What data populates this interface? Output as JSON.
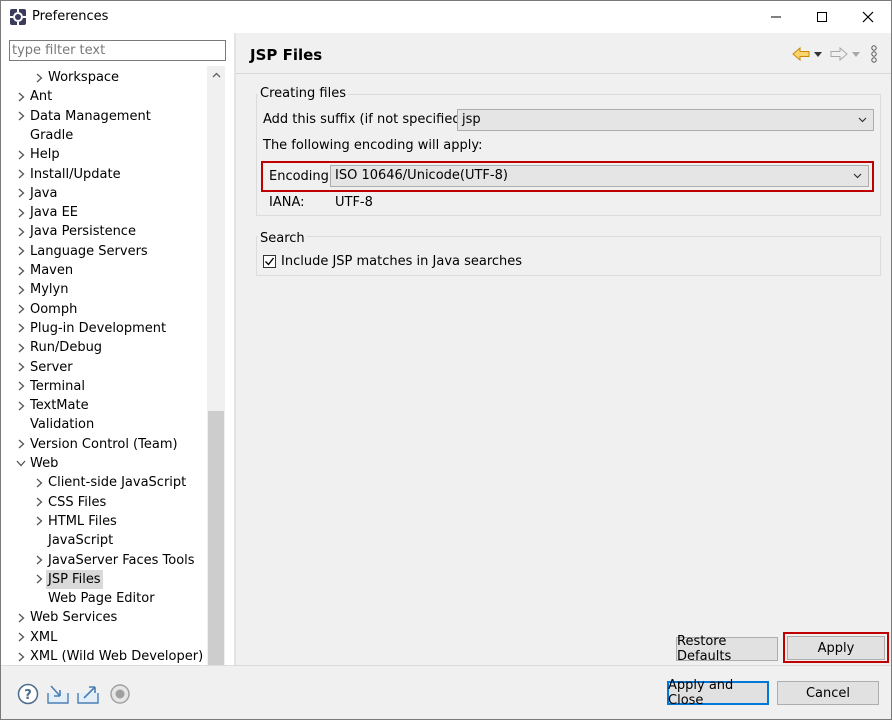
{
  "window": {
    "title": "Preferences"
  },
  "filter": {
    "placeholder": "type filter text"
  },
  "tree": {
    "items": [
      {
        "label": "Workspace",
        "level": 1,
        "expander": "collapsed"
      },
      {
        "label": "Ant",
        "level": 0,
        "expander": "collapsed"
      },
      {
        "label": "Data Management",
        "level": 0,
        "expander": "collapsed"
      },
      {
        "label": "Gradle",
        "level": 0,
        "expander": "none"
      },
      {
        "label": "Help",
        "level": 0,
        "expander": "collapsed"
      },
      {
        "label": "Install/Update",
        "level": 0,
        "expander": "collapsed"
      },
      {
        "label": "Java",
        "level": 0,
        "expander": "collapsed"
      },
      {
        "label": "Java EE",
        "level": 0,
        "expander": "collapsed"
      },
      {
        "label": "Java Persistence",
        "level": 0,
        "expander": "collapsed"
      },
      {
        "label": "Language Servers",
        "level": 0,
        "expander": "collapsed"
      },
      {
        "label": "Maven",
        "level": 0,
        "expander": "collapsed"
      },
      {
        "label": "Mylyn",
        "level": 0,
        "expander": "collapsed"
      },
      {
        "label": "Oomph",
        "level": 0,
        "expander": "collapsed"
      },
      {
        "label": "Plug-in Development",
        "level": 0,
        "expander": "collapsed"
      },
      {
        "label": "Run/Debug",
        "level": 0,
        "expander": "collapsed"
      },
      {
        "label": "Server",
        "level": 0,
        "expander": "collapsed"
      },
      {
        "label": "Terminal",
        "level": 0,
        "expander": "collapsed"
      },
      {
        "label": "TextMate",
        "level": 0,
        "expander": "collapsed"
      },
      {
        "label": "Validation",
        "level": 0,
        "expander": "none"
      },
      {
        "label": "Version Control (Team)",
        "level": 0,
        "expander": "collapsed"
      },
      {
        "label": "Web",
        "level": 0,
        "expander": "expanded"
      },
      {
        "label": "Client-side JavaScript",
        "level": 1,
        "expander": "collapsed"
      },
      {
        "label": "CSS Files",
        "level": 1,
        "expander": "collapsed"
      },
      {
        "label": "HTML Files",
        "level": 1,
        "expander": "collapsed"
      },
      {
        "label": "JavaScript",
        "level": 1,
        "expander": "none"
      },
      {
        "label": "JavaServer Faces Tools",
        "level": 1,
        "expander": "collapsed"
      },
      {
        "label": "JSP Files",
        "level": 1,
        "expander": "collapsed",
        "selected": true
      },
      {
        "label": "Web Page Editor",
        "level": 1,
        "expander": "none"
      },
      {
        "label": "Web Services",
        "level": 0,
        "expander": "collapsed"
      },
      {
        "label": "XML",
        "level": 0,
        "expander": "collapsed"
      },
      {
        "label": "XML (Wild Web Developer)",
        "level": 0,
        "expander": "collapsed"
      }
    ]
  },
  "page": {
    "title": "JSP Files",
    "creating_files": {
      "group_title": "Creating files",
      "suffix_label": "Add this suffix (if not specified):",
      "suffix_value": "jsp",
      "encoding_intro": "The following encoding will apply:",
      "encoding_label": "Encoding:",
      "encoding_value": "ISO 10646/Unicode(UTF-8)",
      "iana_label": "IANA:",
      "iana_value": "UTF-8"
    },
    "search": {
      "group_title": "Search",
      "include_label": "Include JSP matches in Java searches",
      "include_checked": true
    }
  },
  "buttons": {
    "restore_defaults": "Restore Defaults",
    "apply": "Apply",
    "apply_and_close": "Apply and Close",
    "cancel": "Cancel"
  },
  "colors": {
    "highlight": "#c00000",
    "selection": "#d9d9d9",
    "default_button_border": "#0078d7",
    "nav_back_arrow": "#e8a317"
  }
}
